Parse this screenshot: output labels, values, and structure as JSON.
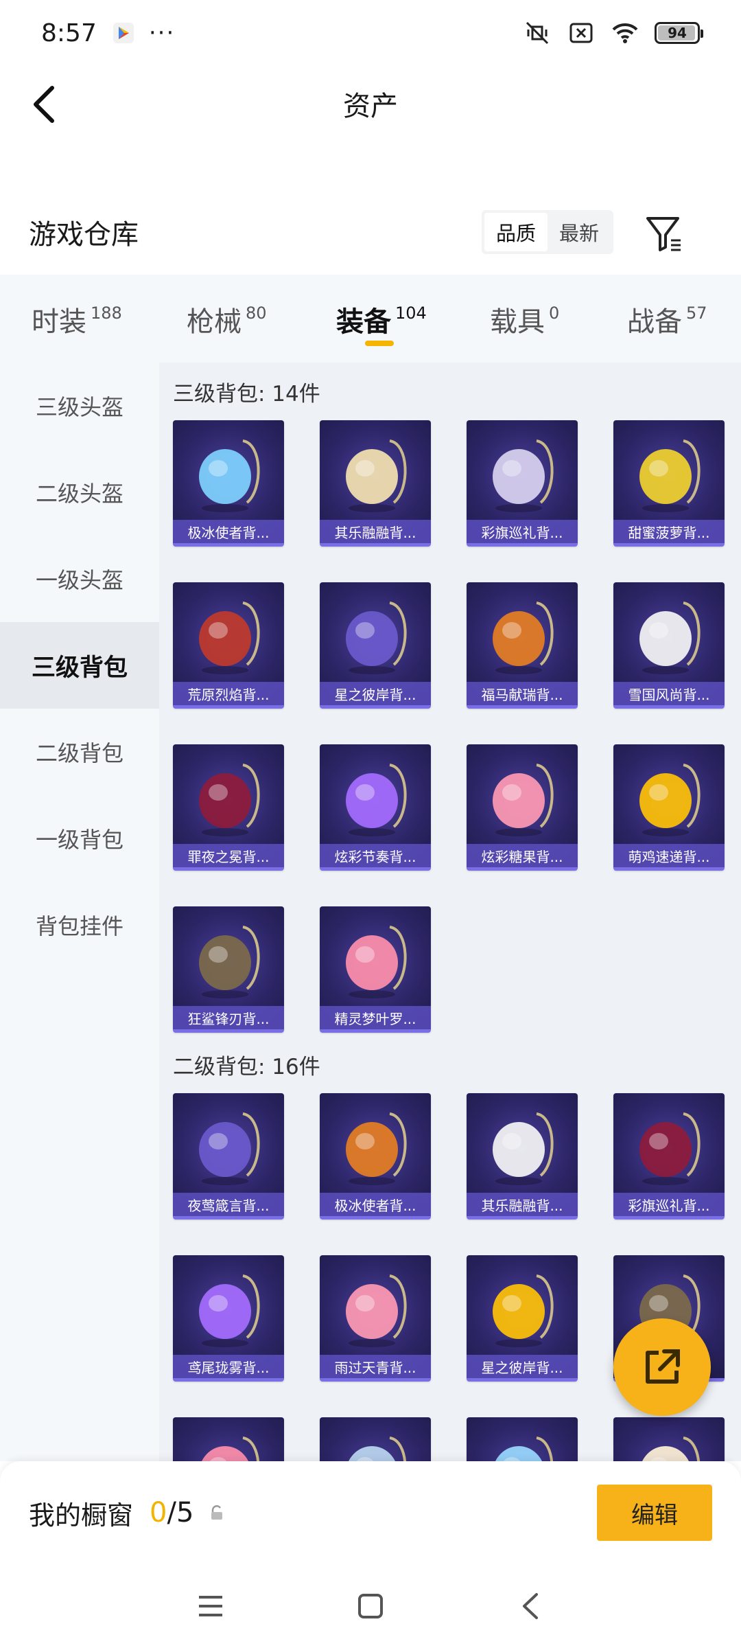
{
  "status_bar": {
    "time": "8:57",
    "battery": "94"
  },
  "header": {
    "title": "资产"
  },
  "section": {
    "title": "游戏仓库",
    "sort_options": [
      "品质",
      "最新"
    ]
  },
  "tabs": [
    {
      "label": "时装",
      "count": "188"
    },
    {
      "label": "枪械",
      "count": "80"
    },
    {
      "label": "装备",
      "count": "104"
    },
    {
      "label": "载具",
      "count": "0"
    },
    {
      "label": "战备",
      "count": "57"
    }
  ],
  "sidebar": {
    "items": [
      "三级头盔",
      "二级头盔",
      "一级头盔",
      "三级背包",
      "二级背包",
      "一级背包",
      "背包挂件"
    ],
    "active": "三级背包"
  },
  "groups": [
    {
      "title": "三级背包: 14件",
      "items": [
        {
          "label": "极冰使者背...",
          "icon": "ice-crystal-backpack-icon"
        },
        {
          "label": "其乐融融背...",
          "icon": "cupcake-backpack-icon"
        },
        {
          "label": "彩旗巡礼背...",
          "icon": "ribbon-backpack-icon"
        },
        {
          "label": "甜蜜菠萝背...",
          "icon": "pineapple-backpack-icon"
        },
        {
          "label": "荒原烈焰背...",
          "icon": "flame-backpack-icon"
        },
        {
          "label": "星之彼岸背...",
          "icon": "astronaut-backpack-icon"
        },
        {
          "label": "福马献瑞背...",
          "icon": "horse-backpack-icon"
        },
        {
          "label": "雪国风尚背...",
          "icon": "snowman-backpack-icon"
        },
        {
          "label": "罪夜之冕背...",
          "icon": "crown-backpack-icon"
        },
        {
          "label": "炫彩节奏背...",
          "icon": "rhythm-backpack-icon"
        },
        {
          "label": "炫彩糖果背...",
          "icon": "candy-backpack-icon"
        },
        {
          "label": "萌鸡速递背...",
          "icon": "chicken-backpack-icon"
        },
        {
          "label": "狂鲨锋刃背...",
          "icon": "shark-backpack-icon"
        },
        {
          "label": "精灵梦叶罗...",
          "icon": "heart-backpack-icon"
        }
      ]
    },
    {
      "title": "二级背包: 16件",
      "items": [
        {
          "label": "夜莺箴言背...",
          "icon": "nightingale-backpack-icon"
        },
        {
          "label": "极冰使者背...",
          "icon": "ice-crystal-backpack-icon"
        },
        {
          "label": "其乐融融背...",
          "icon": "cupcake-backpack-icon"
        },
        {
          "label": "彩旗巡礼背...",
          "icon": "ribbon-backpack-icon"
        },
        {
          "label": "鸢尾珑雾背...",
          "icon": "iris-backpack-icon"
        },
        {
          "label": "雨过天青背...",
          "icon": "celadon-backpack-icon"
        },
        {
          "label": "星之彼岸背...",
          "icon": "astronaut-backpack-icon"
        },
        {
          "label": "",
          "icon": "backpack-icon"
        },
        {
          "label": "",
          "icon": "pineapple-backpack-icon"
        },
        {
          "label": "",
          "icon": "backpack-icon"
        },
        {
          "label": "",
          "icon": "backpack-icon"
        },
        {
          "label": "",
          "icon": "backpack-icon"
        }
      ]
    }
  ],
  "showcase": {
    "label": "我的橱窗",
    "current": "0",
    "total": "/5",
    "edit_label": "编辑"
  },
  "colors": {
    "accent": "#f7b21a",
    "card_bg": "#2c2566",
    "card_label": "#5a4ebe"
  }
}
